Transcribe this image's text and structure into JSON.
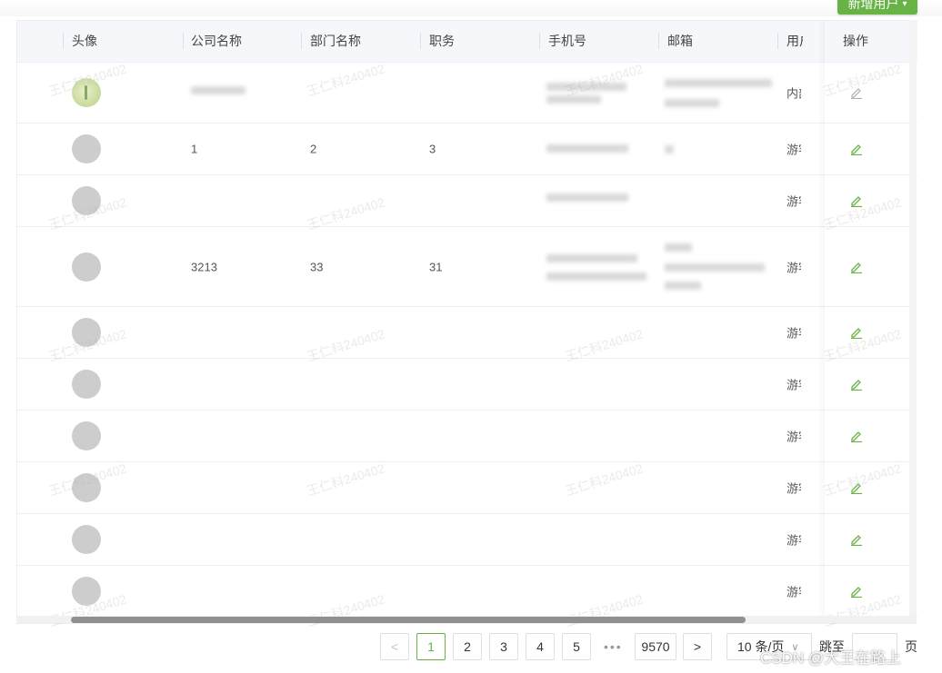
{
  "toolbar": {
    "add_user_label": "新增用户",
    "add_user_chevron": "▾"
  },
  "columns": {
    "avatar": "头像",
    "company": "公司名称",
    "department": "部门名称",
    "position": "职务",
    "phone": "手机号",
    "email": "邮箱",
    "user_type": "用户类型",
    "actions": "操作"
  },
  "rows": [
    {
      "company": "",
      "department": "",
      "position": "",
      "user_type": "内部",
      "avatar": "image"
    },
    {
      "company": "1",
      "department": "2",
      "position": "3",
      "user_type": "游客",
      "avatar": "placeholder"
    },
    {
      "company": "",
      "department": "",
      "position": "",
      "user_type": "游客",
      "avatar": "placeholder"
    },
    {
      "company": "3213",
      "department": "33",
      "position": "31",
      "user_type": "游客",
      "avatar": "placeholder"
    },
    {
      "company": "",
      "department": "",
      "position": "",
      "user_type": "游客",
      "avatar": "placeholder"
    },
    {
      "company": "",
      "department": "",
      "position": "",
      "user_type": "游客",
      "avatar": "placeholder"
    },
    {
      "company": "",
      "department": "",
      "position": "",
      "user_type": "游客",
      "avatar": "placeholder"
    },
    {
      "company": "",
      "department": "",
      "position": "",
      "user_type": "游客",
      "avatar": "placeholder"
    },
    {
      "company": "",
      "department": "",
      "position": "",
      "user_type": "游客",
      "avatar": "placeholder"
    },
    {
      "company": "",
      "department": "",
      "position": "",
      "user_type": "游客",
      "avatar": "placeholder"
    }
  ],
  "watermark_text": "王仁科240402",
  "pagination": {
    "prev": "<",
    "pages": [
      "1",
      "2",
      "3",
      "4",
      "5"
    ],
    "active_page": "1",
    "ellipsis": "•••",
    "last_page": "9570",
    "next": ">",
    "page_size": "10 条/页",
    "page_size_chevron": "∨",
    "jump_label": "跳至",
    "jump_value": "",
    "page_unit": "页"
  },
  "credit": "CSDN @大王在路上",
  "colors": {
    "accent": "#67b345",
    "header_bg": "#f5f7fa",
    "border": "#ebeef5"
  }
}
